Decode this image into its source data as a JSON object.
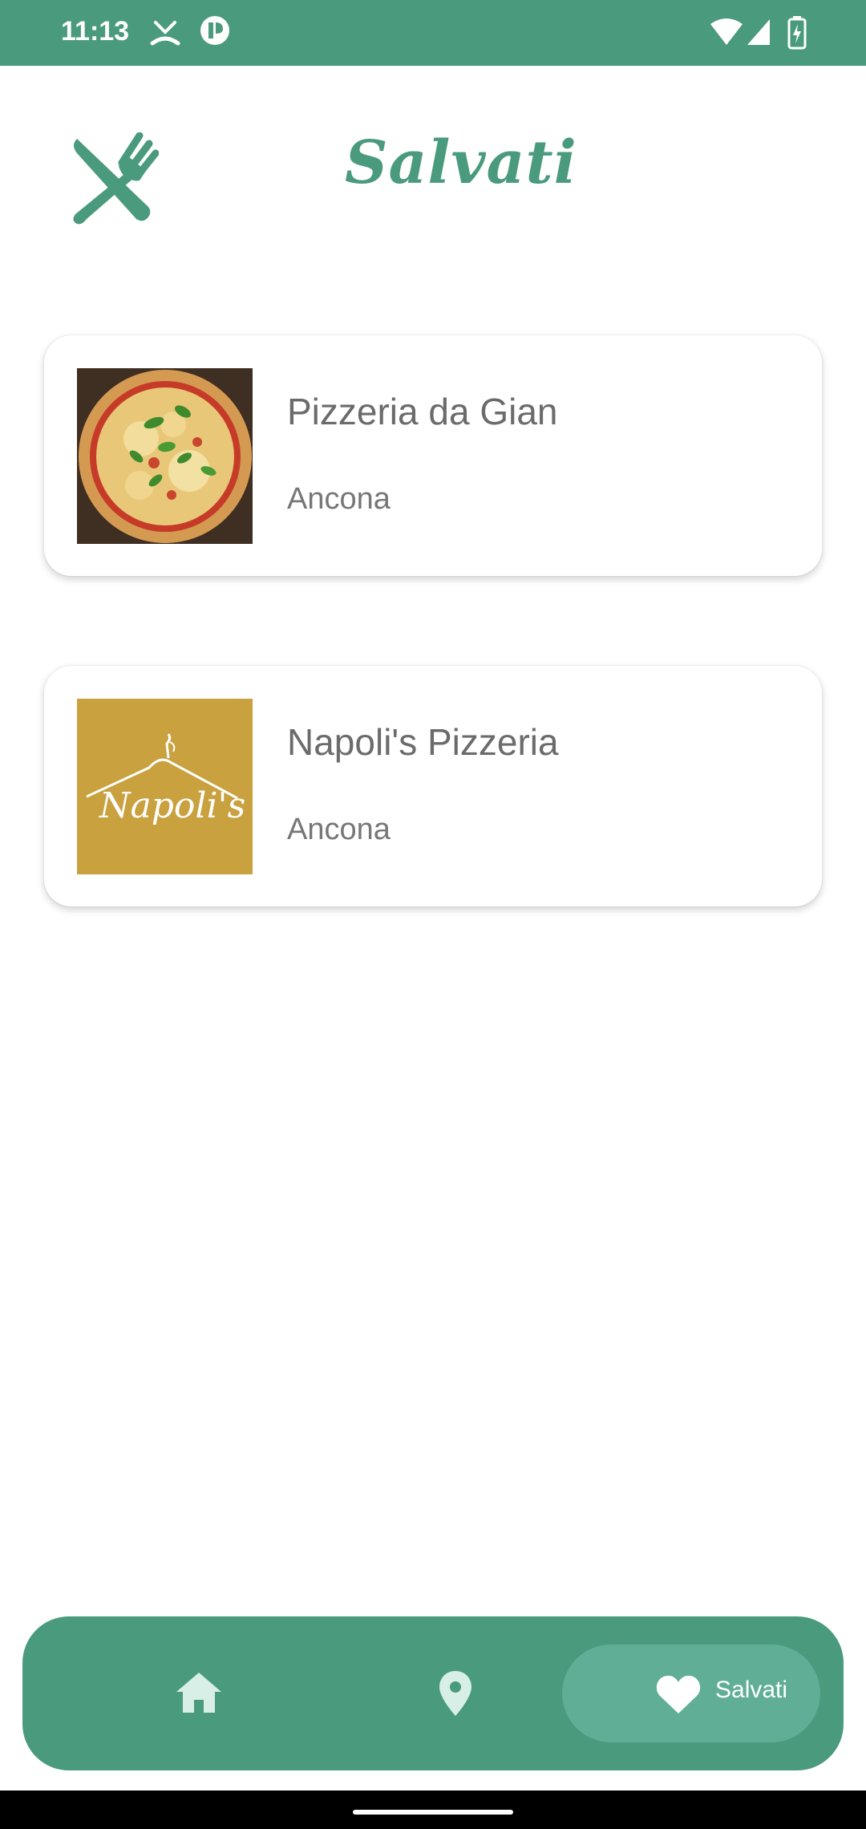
{
  "status_bar": {
    "time": "11:13",
    "icons": [
      "missed-call-icon",
      "app-notification-icon",
      "wifi-icon",
      "signal-icon",
      "battery-charging-icon"
    ]
  },
  "header": {
    "title": "Salvati",
    "icon": "fork-knife-icon"
  },
  "saved_list": [
    {
      "name": "Pizzeria da Gian",
      "city": "Ancona",
      "image": "pizza-photo"
    },
    {
      "name": "Napoli's Pizzeria",
      "city": "Ancona",
      "image": "napolis-logo",
      "logo_text": "Napoli's"
    }
  ],
  "bottom_nav": {
    "items": [
      {
        "icon": "home-icon"
      },
      {
        "icon": "location-pin-icon"
      },
      {
        "icon": "heart-icon",
        "label": "Salvati",
        "active": true
      }
    ]
  },
  "colors": {
    "accent": "#4a9a7e",
    "active_pill": "#5fae95",
    "nav_icon_inactive": "#d7efe6",
    "logo_bg": "#c9a13f"
  }
}
